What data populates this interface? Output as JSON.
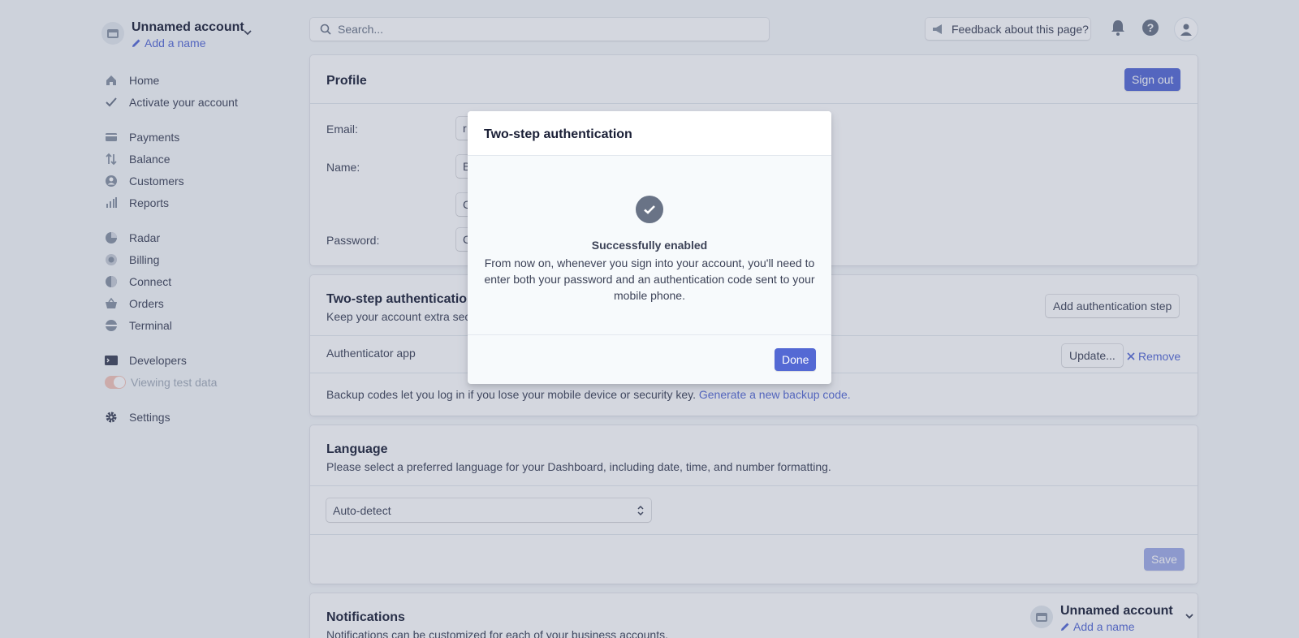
{
  "account": {
    "name": "Unnamed account",
    "add_name": "Add a name"
  },
  "nav": {
    "home": "Home",
    "activate": "Activate your account",
    "payments": "Payments",
    "balance": "Balance",
    "customers": "Customers",
    "reports": "Reports",
    "radar": "Radar",
    "billing": "Billing",
    "connect": "Connect",
    "orders": "Orders",
    "terminal": "Terminal",
    "developers": "Developers",
    "test_data": "Viewing test data",
    "settings": "Settings"
  },
  "topbar": {
    "search_placeholder": "Search...",
    "feedback": "Feedback about this page?"
  },
  "profile": {
    "title": "Profile",
    "sign_out": "Sign out",
    "email_label": "Email:",
    "email_value": "r",
    "name_label": "Name:",
    "name_value": "B",
    "extra_value": "C",
    "password_label": "Password:",
    "password_value": "C"
  },
  "two_step": {
    "title": "Two-step authentication",
    "subtitle": "Keep your account extra secu",
    "add_step": "Add authentication step",
    "method": "Authenticator app",
    "update": "Update...",
    "remove": "Remove",
    "backup_text": "Backup codes let you log in if you lose your mobile device or security key.",
    "backup_link": "Generate a new backup code."
  },
  "language": {
    "title": "Language",
    "subtitle": "Please select a preferred language for your Dashboard, including date, time, and number formatting.",
    "selected": "Auto-detect",
    "save": "Save"
  },
  "notifications": {
    "title": "Notifications",
    "subtitle": "Notifications can be customized for each of your business accounts.",
    "account_name": "Unnamed account",
    "add_name": "Add a name"
  },
  "modal": {
    "title": "Two-step authentication",
    "status": "Successfully enabled",
    "description": "From now on, whenever you sign into your account, you'll need to enter both your password and an authentication code sent to your mobile phone.",
    "done": "Done"
  },
  "colors": {
    "accent": "#5469d4",
    "overlay": "rgba(82, 95, 127, 0.25)",
    "test_toggle": "#f5c4b8"
  }
}
